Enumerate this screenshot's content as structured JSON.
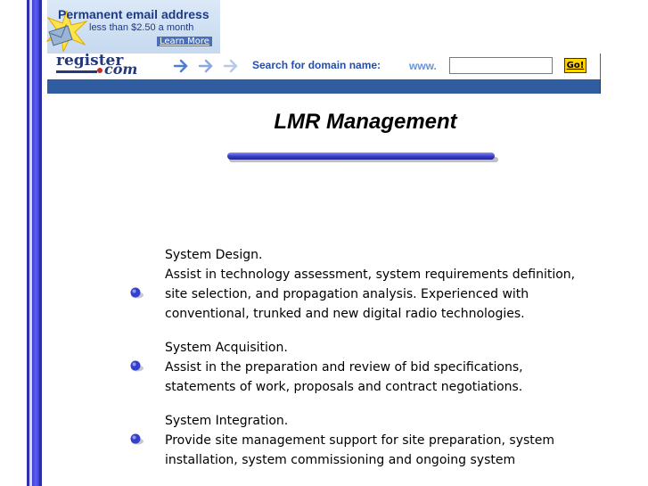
{
  "ad": {
    "title": "Permanent email address",
    "subtitle": "less than $2.50 a month",
    "link": "Learn More"
  },
  "registerbar": {
    "logo_main": "register",
    "logo_suffix": "com",
    "search_label": "Search for domain name:",
    "prefix": "www.",
    "input_value": "",
    "go_label": "Go!"
  },
  "page": {
    "title": "LMR Management"
  },
  "services": [
    {
      "title": "System Design.",
      "desc": "Assist in technology assessment, system requirements definition, site selection, and propagation analysis. Experienced with conventional, trunked and new digital radio technologies."
    },
    {
      "title": "System Acquisition.",
      "desc": "Assist in the preparation and review of bid specifications, statements of work, proposals and contract negotiations."
    },
    {
      "title": "System Integration.",
      "desc": "Provide site management support for site preparation, system installation, system commissioning and ongoing system"
    }
  ],
  "colors": {
    "border_blue": "#3b3fd6",
    "banner_strip": "#2f5d9f",
    "go_yellow": "#ffd400",
    "bullet_blue": "#3340c9"
  }
}
